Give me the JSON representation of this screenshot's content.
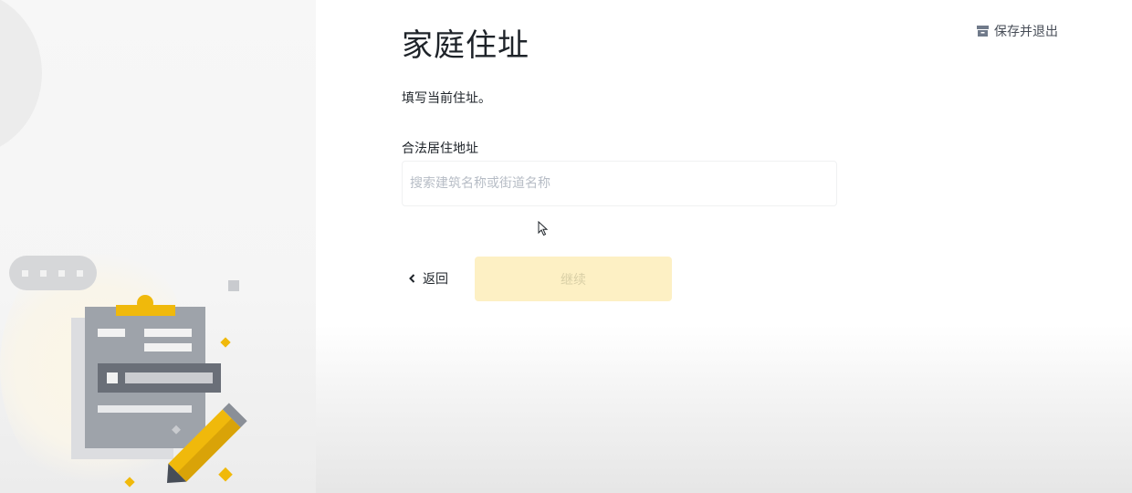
{
  "header": {
    "title": "家庭住址",
    "save_exit_label": "保存并退出"
  },
  "form": {
    "subtitle": "填写当前住址。",
    "address_label": "合法居住地址",
    "address_placeholder": "搜索建筑名称或街道名称",
    "address_value": ""
  },
  "actions": {
    "back_label": "返回",
    "continue_label": "继续",
    "continue_disabled": true
  },
  "colors": {
    "accent": "#fcd535",
    "continue_disabled_bg": "#fdf0c4",
    "text_primary": "#1e2329",
    "border": "#f0f1f2"
  },
  "icons": {
    "save_exit": "archive-icon",
    "back": "chevron-left-icon",
    "illustration": "clipboard-pencil-illustration"
  }
}
